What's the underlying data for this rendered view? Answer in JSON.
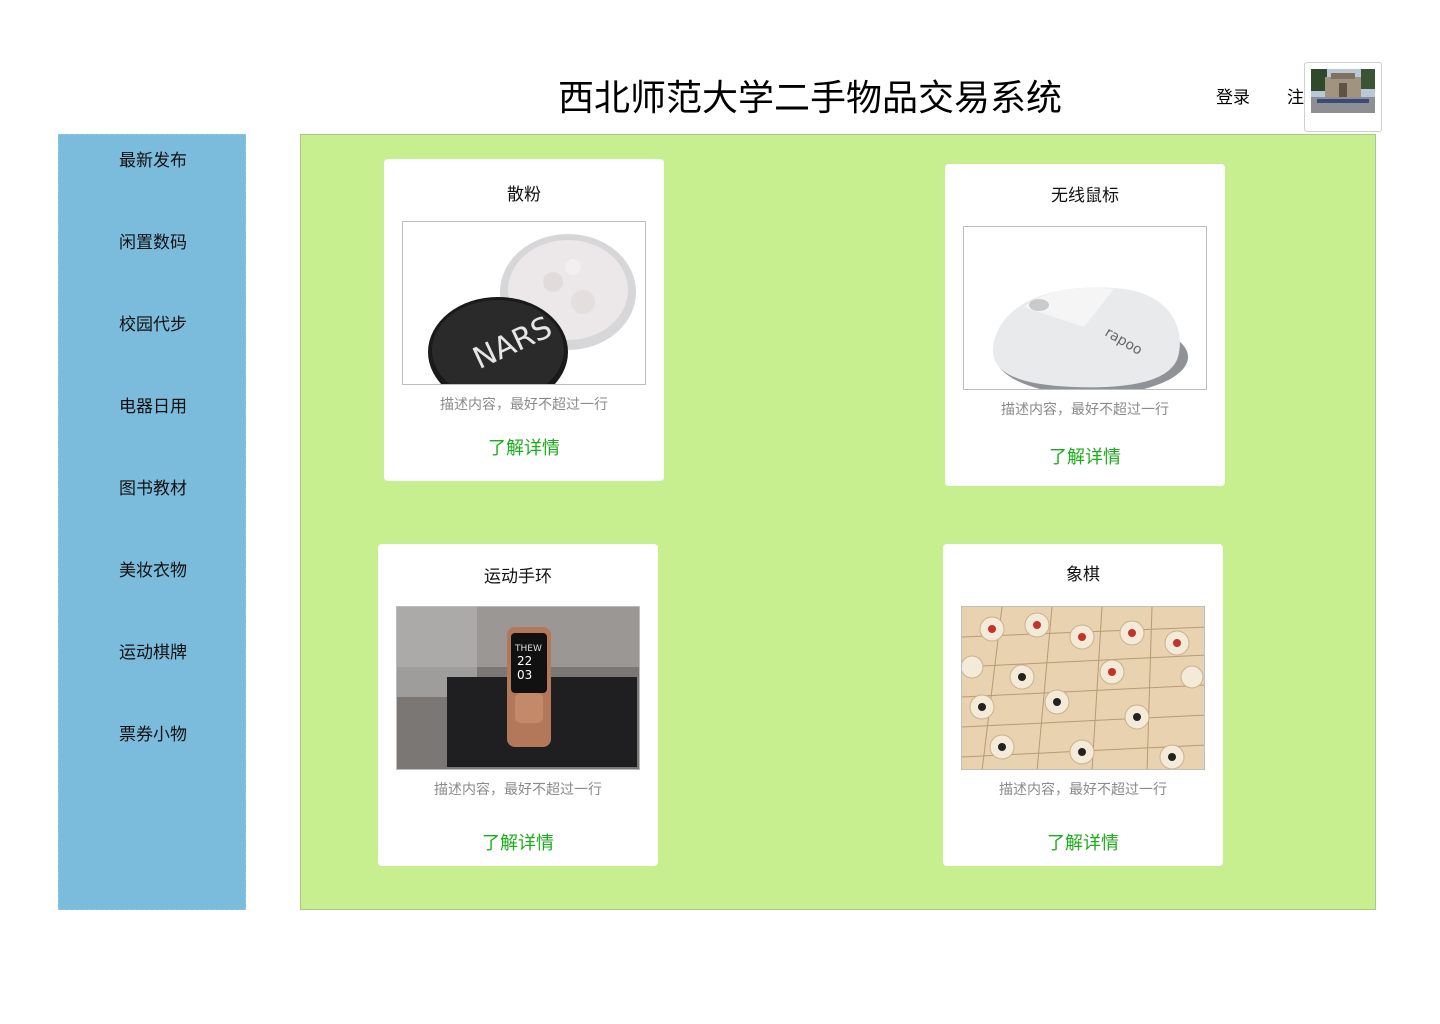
{
  "header": {
    "title": "西北师范大学二手物品交易系统",
    "login_label": "登录",
    "register_label": "注册"
  },
  "sidebar": {
    "items": [
      {
        "label": "最新发布"
      },
      {
        "label": "闲置数码"
      },
      {
        "label": "校园代步"
      },
      {
        "label": "电器日用"
      },
      {
        "label": "图书教材"
      },
      {
        "label": "美妆衣物"
      },
      {
        "label": "运动棋牌"
      },
      {
        "label": "票券小物"
      }
    ]
  },
  "products": [
    {
      "title": "散粉",
      "image_icon": "loose-powder-image",
      "description": "描述内容，最好不超过一行",
      "link_label": "了解详情"
    },
    {
      "title": "无线鼠标",
      "image_icon": "wireless-mouse-image",
      "description": "描述内容，最好不超过一行",
      "link_label": "了解详情"
    },
    {
      "title": "运动手环",
      "image_icon": "fitness-band-image",
      "description": "描述内容，最好不超过一行",
      "link_label": "了解详情"
    },
    {
      "title": "象棋",
      "image_icon": "chinese-chess-image",
      "description": "描述内容，最好不超过一行",
      "link_label": "了解详情"
    }
  ],
  "colors": {
    "sidebar_bg": "#7bbcdc",
    "main_bg": "#c7ef90",
    "link_green": "#1aad19"
  }
}
